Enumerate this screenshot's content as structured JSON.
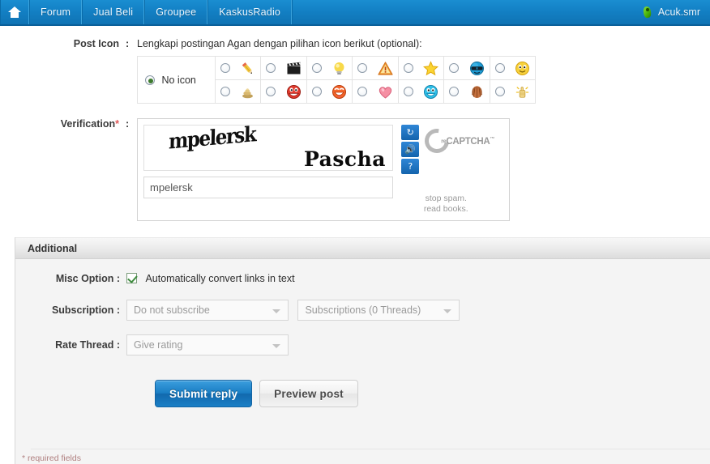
{
  "navbar": {
    "home_icon": "home-icon",
    "items": [
      {
        "label": "Forum"
      },
      {
        "label": "Jual Beli"
      },
      {
        "label": "Groupee"
      },
      {
        "label": "KaskusRadio"
      }
    ],
    "user": {
      "name": "Acuk.smr",
      "icon": "user-avatar-icon"
    },
    "background_color": "#1380c4"
  },
  "post_icon": {
    "label": "Post Icon",
    "colon": ":",
    "hint": "Lengkapi postingan Agan dengan pilihan icon berikut (optional):",
    "no_icon_label": "No icon",
    "selected": "no-icon",
    "row1": [
      {
        "name": "pencil-icon",
        "glyph": "✏"
      },
      {
        "name": "clapperboard-icon",
        "glyph": "🎬"
      },
      {
        "name": "lightbulb-icon",
        "glyph": "💡"
      },
      {
        "name": "warning-icon",
        "glyph": "⚠"
      },
      {
        "name": "star-icon",
        "glyph": "⭐"
      },
      {
        "name": "cool-sunglasses-icon",
        "glyph": "😎"
      },
      {
        "name": "smiley-yellow-icon",
        "glyph": "😊"
      }
    ],
    "row2": [
      {
        "name": "poop-icon",
        "glyph": "💩"
      },
      {
        "name": "red-grin-icon",
        "glyph": "😃"
      },
      {
        "name": "laughing-icon",
        "glyph": "😆"
      },
      {
        "name": "heart-icon",
        "glyph": "💗"
      },
      {
        "name": "blue-smiley-icon",
        "glyph": "😃"
      },
      {
        "name": "shell-icon",
        "glyph": "🐚"
      },
      {
        "name": "thumbs-up-icon",
        "glyph": "👍"
      }
    ]
  },
  "verification": {
    "label": "Verification",
    "required_mark": "*",
    "colon": ":",
    "captcha_word1": "mpelersk",
    "captcha_word2": "Pascha",
    "input_value": "mpelersk",
    "recaptcha_brand_prefix": "re",
    "recaptcha_brand": "CAPTCHA",
    "recaptcha_tm": "™",
    "tagline_line1": "stop spam.",
    "tagline_line2": "read books.",
    "buttons": [
      {
        "name": "recaptcha-refresh-button",
        "glyph": "↻"
      },
      {
        "name": "recaptcha-audio-button",
        "glyph": "🔊"
      },
      {
        "name": "recaptcha-help-button",
        "glyph": "?"
      }
    ]
  },
  "additional": {
    "heading": "Additional",
    "misc_option": {
      "label": "Misc Option",
      "colon": ":",
      "checkbox_label": "Automatically convert links in text",
      "checked": true
    },
    "subscription": {
      "label": "Subscription",
      "colon": ":",
      "select1_value": "Do not subscribe",
      "select2_value": "Subscriptions (0 Threads)"
    },
    "rate_thread": {
      "label": "Rate Thread",
      "colon": ":",
      "select_value": "Give rating"
    },
    "buttons": {
      "submit": "Submit reply",
      "preview": "Preview post"
    }
  },
  "footer": {
    "required_note": "* required fields"
  }
}
